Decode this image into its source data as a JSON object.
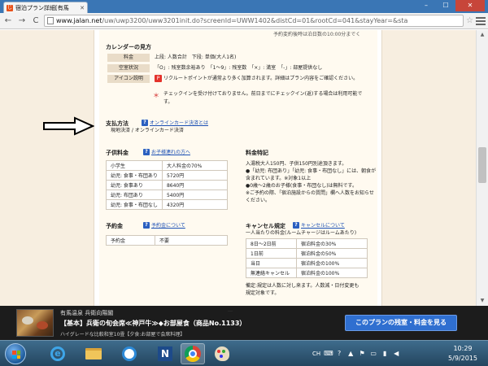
{
  "browser": {
    "tab_title": "宿泊プラン詳細[有馬",
    "tab_favicon": "じ",
    "url_host": "www.jalan.net",
    "url_rest": "/uw/uwp3200/uww3201init.do?screenId=UWW1402&distCd=01&rootCd=041&stayYear=&sta",
    "min_icon": "minimize-icon",
    "max_icon": "maximize-icon",
    "close_glyph": "✕",
    "min_glyph": "–",
    "max_glyph": "☐",
    "back_glyph": "←",
    "forward_glyph": "→",
    "reload_glyph": "C",
    "star_glyph": "☆"
  },
  "page": {
    "top_note": "予約変約後時は泊日数の10:00分までく",
    "calendar": {
      "heading": "カレンダーの見方",
      "rows": [
        {
          "label": "料金",
          "text": "上段: 人数合計　下段: 単価(大人1名)"
        },
        {
          "label": "空室状況",
          "text": "「O」: 残室数余裕あり　「1〜9」: 残室数　「×」: 満室　「-」: 部屋提供なし"
        },
        {
          "label": "アイコン説明",
          "icon": "P",
          "text": "リクルートポイントが通常より多く加算されます。詳細はプラン内容をご確認ください。"
        }
      ],
      "note_mark": "＊",
      "note_lines": [
        "チェックインを受け付けておりません。前日までにチェックイン(返)する場合は利用可能で",
        "す。"
      ]
    },
    "payment": {
      "heading": "支払方法",
      "link": "オンラインカード決済とは",
      "value": "現地決済 / オンラインカード決済",
      "help_glyph": "?"
    },
    "child_fee": {
      "heading": "子供料金",
      "link": "お子様連れの方へ",
      "rows": [
        [
          "小学生",
          "大人料金の70%"
        ],
        [
          "幼児: 食事・布団あり",
          "5720円"
        ],
        [
          "幼児: 食事あり",
          "8640円"
        ],
        [
          "幼児: 布団あり",
          "5400円"
        ],
        [
          "幼児: 食事・布団なし",
          "4320円"
        ]
      ]
    },
    "fee_notes": {
      "heading": "料金特記",
      "lines": [
        "入湯税大人150円、子供150円別途頂きます。",
        "●「幼児: 布団あり」「幼児: 食事・布団なし」には、朝食が",
        "含まれています。※対象1以上",
        "●0歳〜2歳のお子様(食事・布団なし)は無料です。",
        "※ご予約の際、「宿泊施設からの質問」欄へ人数をお知らせ",
        "ください。"
      ]
    },
    "deposit": {
      "heading": "予約金",
      "link": "予約金について",
      "rows": [
        [
          "予約金",
          "不要"
        ]
      ]
    },
    "cancel": {
      "heading": "キャンセル規定",
      "link": "キャンセルについて",
      "sub": "一人当たりの料金(ルームチャージはルームあたり)",
      "rows": [
        [
          "8日〜2日前",
          "宿泊料金の30%"
        ],
        [
          "1日前",
          "宿泊料金の50%"
        ],
        [
          "当日",
          "宿泊料金の100%"
        ],
        [
          "無連絡キャンセル",
          "宿泊料金の100%"
        ]
      ],
      "note_lines": [
        "備定:規定は人数に対し来ます。人数減・日付変更も",
        "規定対象です。"
      ]
    }
  },
  "banner": {
    "faded_text": "…",
    "hotel": "有馬温泉 兵衛向陽閣",
    "plan": "【基本】兵衛の旬会席≪神戸牛≫◆お部屋食（商品No.1133）",
    "sub": "ハイグレードな比較和室10畳【夕食:お部屋で会席料理】",
    "cta": "このプランの残室・料金を見る"
  },
  "taskbar": {
    "lang": "CH",
    "time": "10:29",
    "date": "5/9/2015",
    "apps": [
      "ie-icon",
      "folder-icon",
      "qq-icon",
      "n-app-icon",
      "chrome-icon",
      "paint-icon"
    ]
  }
}
